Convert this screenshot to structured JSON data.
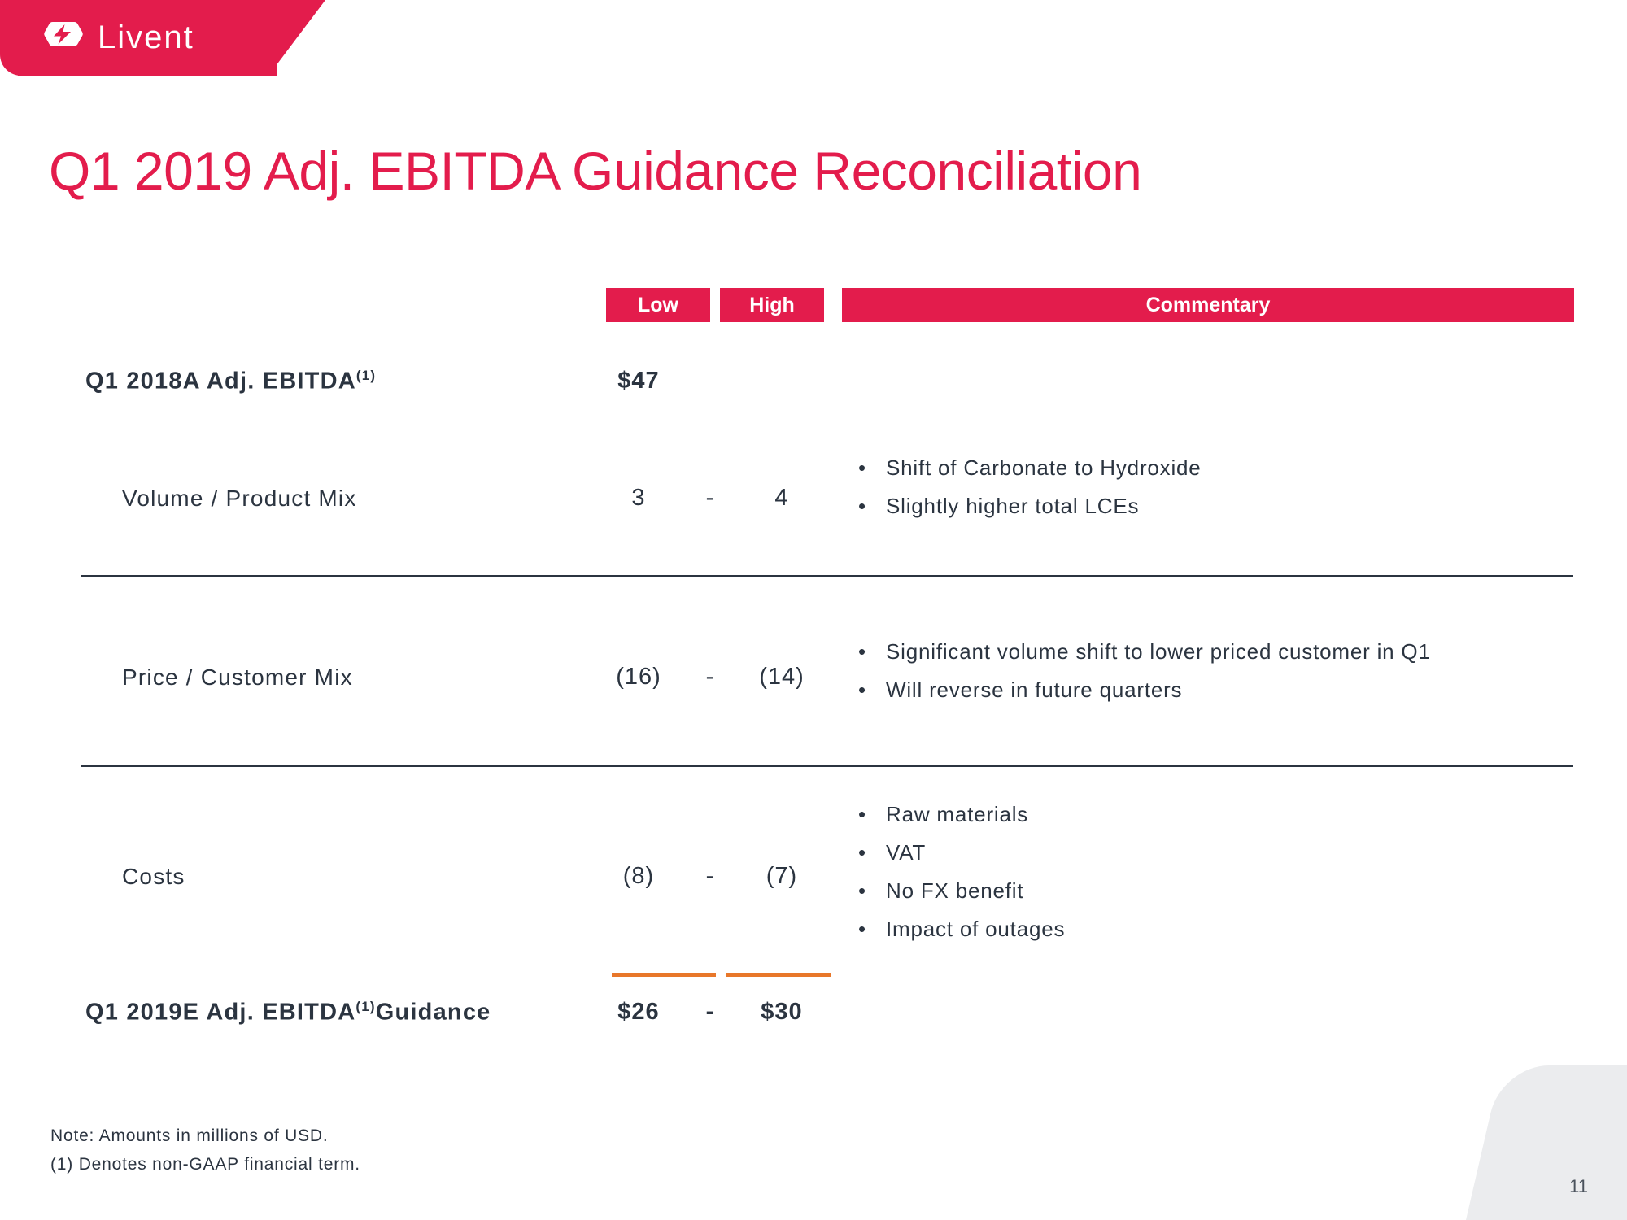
{
  "brand": {
    "name": "Livent",
    "logo_icon": "livent-hexagon-bolt-icon",
    "accent_crimson": "#E31C4C",
    "accent_orange": "#E8772A",
    "text_navy": "#2b3440"
  },
  "title": "Q1 2019 Adj. EBITDA Guidance Reconciliation",
  "table": {
    "headers": {
      "low": "Low",
      "high": "High",
      "commentary": "Commentary"
    },
    "opening": {
      "label_main": "Q1 2018A Adj. EBITDA",
      "label_sup": "(1)",
      "value": "$47"
    },
    "rows": [
      {
        "label": "Volume / Product Mix",
        "low": "3",
        "dash": "-",
        "high": "4",
        "commentary": [
          "Shift of Carbonate to Hydroxide",
          "Slightly higher total LCEs"
        ]
      },
      {
        "label": "Price / Customer Mix",
        "low": "(16)",
        "dash": "-",
        "high": "(14)",
        "commentary": [
          "Significant volume shift to lower priced customer in Q1",
          "Will reverse in future quarters"
        ]
      },
      {
        "label": "Costs",
        "low": "(8)",
        "dash": "-",
        "high": "(7)",
        "commentary": [
          "Raw materials",
          "VAT",
          "No FX benefit",
          "Impact of outages"
        ]
      }
    ],
    "total": {
      "label_main": "Q1 2019E Adj. EBITDA",
      "label_sup": "(1)",
      "label_tail": "Guidance",
      "low": "$26",
      "dash": "-",
      "high": "$30"
    }
  },
  "footnotes": {
    "note": "Note: Amounts in millions of USD.",
    "footnote_1": "(1)   Denotes non-GAAP financial term."
  },
  "page_number": "11",
  "bullet_glyph": "•"
}
